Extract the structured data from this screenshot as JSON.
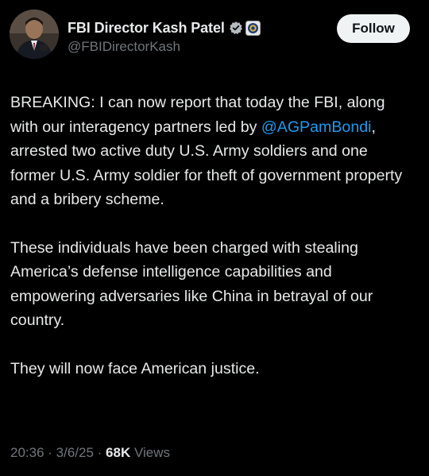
{
  "author": {
    "display_name": "FBI Director Kash Patel",
    "handle": "@FBIDirectorKash",
    "verified_icon": "verified-badge-icon",
    "affiliation_icon": "fbi-seal-icon"
  },
  "follow_label": "Follow",
  "tweet": {
    "p1_before": "BREAKING: I can now report that today the FBI, along with our interagency partners led by ",
    "mention": "@AGPamBondi",
    "p1_after": ", arrested two active duty U.S. Army soldiers and one former U.S. Army soldier for theft of government property and a bribery scheme.",
    "p2": "These individuals have been charged with stealing America’s defense intelligence capabilities and empowering adversaries like China in betrayal of our country.",
    "p3": "They will now face American justice."
  },
  "meta": {
    "time": "20:36",
    "sep1": " · ",
    "date": "3/6/25",
    "sep2": " · ",
    "views_count": "68K",
    "views_label": " Views"
  },
  "colors": {
    "background": "#000000",
    "text": "#e7e9ea",
    "muted": "#71767b",
    "link": "#1d9bf0",
    "button_bg": "#eff3f4"
  }
}
